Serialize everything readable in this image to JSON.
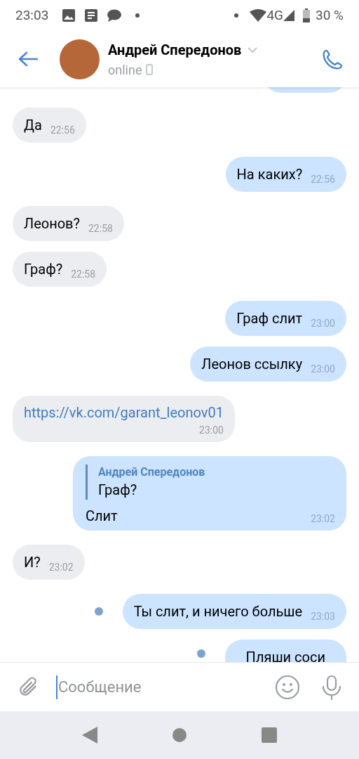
{
  "status_bar": {
    "time": "23:03",
    "network": "4G",
    "battery": "30 %"
  },
  "header": {
    "name": "Андрей Спередонов",
    "status": "online"
  },
  "messages": [
    {
      "kind": "text",
      "outgoing": false,
      "unread": false,
      "text": "Да",
      "time": "22:56"
    },
    {
      "kind": "text",
      "outgoing": true,
      "unread": false,
      "text": "На каких?",
      "time": "22:56"
    },
    {
      "kind": "text",
      "outgoing": false,
      "unread": false,
      "text": "Леонов?",
      "time": "22:58"
    },
    {
      "kind": "text",
      "outgoing": false,
      "unread": false,
      "text": "Граф?",
      "time": "22:58"
    },
    {
      "kind": "text",
      "outgoing": true,
      "unread": false,
      "text": "Граф слит",
      "time": "23:00"
    },
    {
      "kind": "text",
      "outgoing": true,
      "unread": false,
      "text": "Леонов ссылку",
      "time": "23:00"
    },
    {
      "kind": "link",
      "outgoing": false,
      "unread": false,
      "text": "https://vk.com/garant_leonov01",
      "time": "23:00"
    },
    {
      "kind": "reply",
      "outgoing": true,
      "unread": false,
      "reply_author": "Андрей Спередонов",
      "reply_text": "Граф?",
      "text": "Слит",
      "time": "23:02"
    },
    {
      "kind": "text",
      "outgoing": false,
      "unread": false,
      "text": "И?",
      "time": "23:02"
    },
    {
      "kind": "text",
      "outgoing": true,
      "unread": true,
      "text": "Ты слит, и ничего больше",
      "time": "23:03"
    },
    {
      "kind": "partial",
      "outgoing": true,
      "unread": true,
      "text": "Пляши соси"
    }
  ],
  "composer": {
    "placeholder": "Сообщение"
  }
}
